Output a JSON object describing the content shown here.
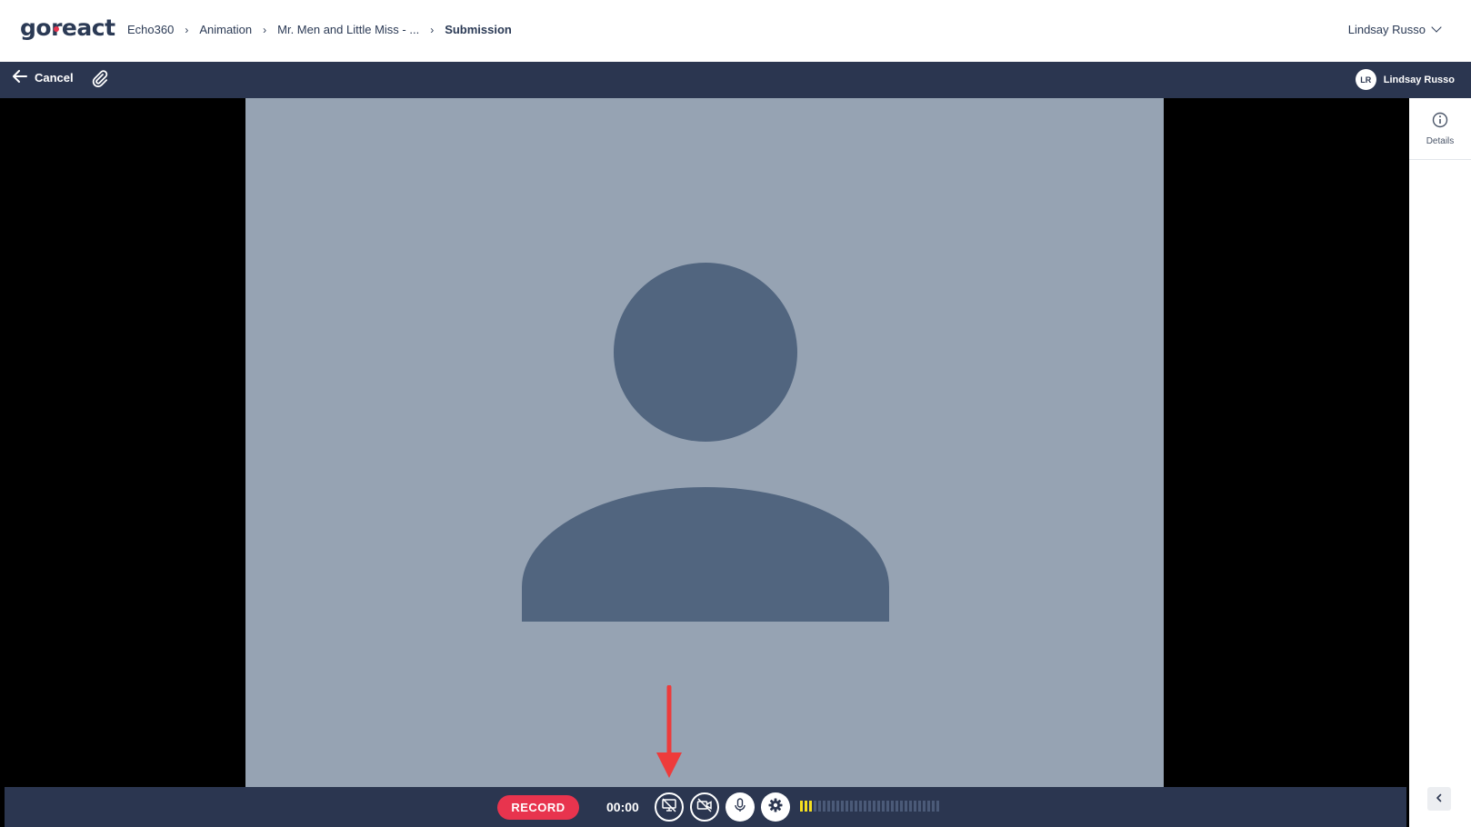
{
  "header": {
    "logo_text": "goreact",
    "breadcrumb": [
      "Echo360",
      "Animation",
      "Mr. Men and Little Miss - ..."
    ],
    "current_page": "Submission",
    "user_name": "Lindsay Russo"
  },
  "toolbar": {
    "cancel_label": "Cancel",
    "user_initials": "LR",
    "user_name": "Lindsay Russo"
  },
  "side_panel": {
    "details_label": "Details"
  },
  "controls": {
    "record_label": "RECORD",
    "timer": "00:00",
    "mic_level_bars_on": 3,
    "mic_level_bars_total": 31
  },
  "colors": {
    "brand_navy": "#2b3650",
    "record_red": "#e8344e",
    "meter_yellow": "#f6e020",
    "annotation_red": "#ee3b3b"
  },
  "icons": [
    "arrow-left-icon",
    "paperclip-icon",
    "info-icon",
    "screen-share-off-icon",
    "camera-off-icon",
    "microphone-icon",
    "gear-icon",
    "chevron-left-icon",
    "chevron-down-icon",
    "chevron-right-icon"
  ]
}
